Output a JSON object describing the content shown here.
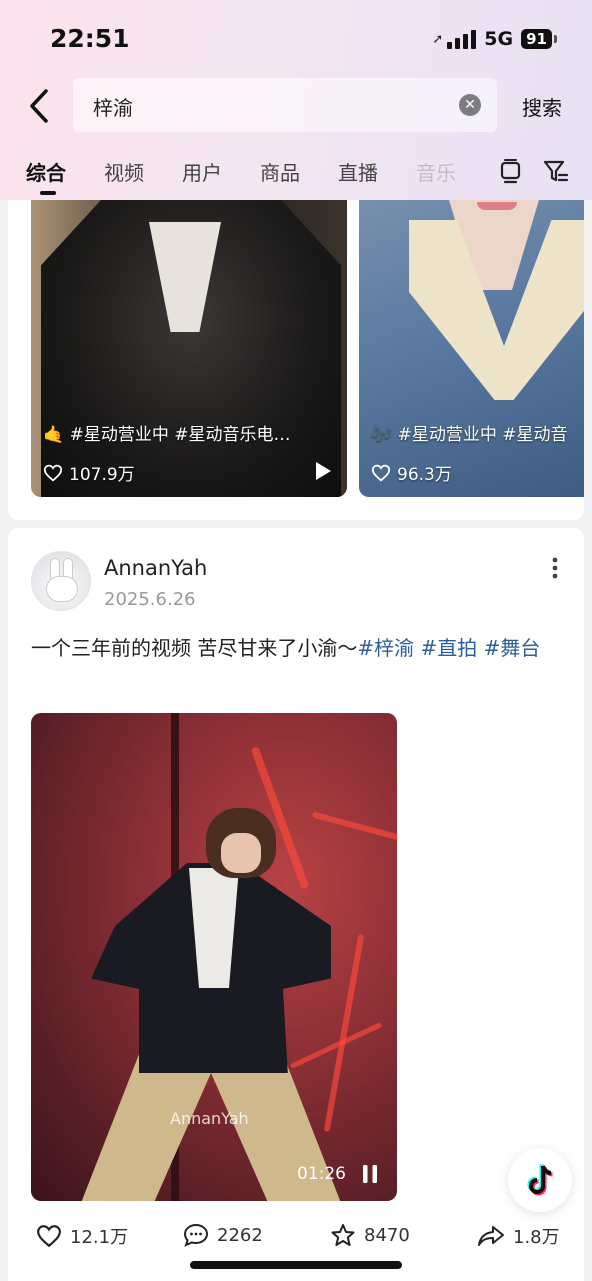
{
  "status_bar": {
    "time": "22:51",
    "network": "5G",
    "battery": "91"
  },
  "search": {
    "query": "梓渝",
    "button": "搜索"
  },
  "tabs": [
    {
      "label": "综合",
      "active": true
    },
    {
      "label": "视频",
      "active": false
    },
    {
      "label": "用户",
      "active": false
    },
    {
      "label": "商品",
      "active": false
    },
    {
      "label": "直播",
      "active": false
    },
    {
      "label": "音乐",
      "active": false
    }
  ],
  "results_top": [
    {
      "caption": "🤙 #星动营业中 #星动音乐电…",
      "likes": "107.9万",
      "icon": "play-icon"
    },
    {
      "caption": "🎶 #星动营业中 #星动音",
      "likes": "96.3万",
      "icon": "music-icon"
    }
  ],
  "post": {
    "username": "AnnanYah",
    "date": "2025.6.26",
    "text": "一个三年前的视频 苦尽甘来了小渝～",
    "tags": [
      "#梓渝",
      "#直拍",
      "#舞台"
    ],
    "video": {
      "watermark": "AnnanYah",
      "duration": "01:26"
    },
    "actions": {
      "likes": "12.1万",
      "comments": "2262",
      "favorites": "8470",
      "shares": "1.8万"
    }
  }
}
